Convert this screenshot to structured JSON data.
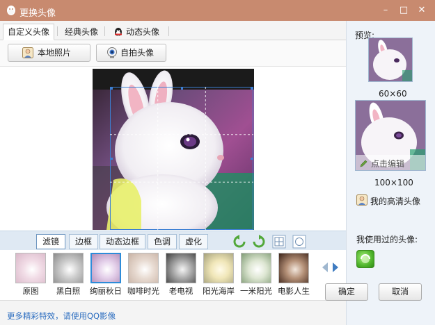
{
  "window": {
    "title": "更换头像",
    "icon": "qq-penguin-icon"
  },
  "title_controls": {
    "minimize": "–",
    "maximize": "□",
    "close": "✕"
  },
  "tabs": [
    {
      "label": "自定义头像",
      "active": true
    },
    {
      "label": "经典头像",
      "active": false
    },
    {
      "label": "动态头像",
      "active": false,
      "icon": "penguin-icon"
    }
  ],
  "toolbar": {
    "local_photo_label": "本地照片",
    "selfie_label": "自拍头像"
  },
  "filter_tabs": [
    {
      "label": "滤镜",
      "active": true
    },
    {
      "label": "边框",
      "active": false
    },
    {
      "label": "动态边框",
      "active": false
    },
    {
      "label": "色调",
      "active": false
    },
    {
      "label": "虚化",
      "active": false
    }
  ],
  "filters": [
    {
      "label": "原图",
      "selected": false,
      "tint": "#d9b7c8"
    },
    {
      "label": "黑白照",
      "selected": false,
      "tint": "#8a8a8a"
    },
    {
      "label": "绚丽秋日",
      "selected": true,
      "tint": "#b08bb6"
    },
    {
      "label": "咖啡时光",
      "selected": false,
      "tint": "#c8b2a4"
    },
    {
      "label": "老电视",
      "selected": false,
      "tint": "#5e5e5e"
    },
    {
      "label": "阳光海岸",
      "selected": false,
      "tint": "#e6d49c"
    },
    {
      "label": "一米阳光",
      "selected": false,
      "tint": "#b7c5a8"
    },
    {
      "label": "电影人生",
      "selected": false,
      "tint": "#6f4a3a"
    }
  ],
  "bottom": {
    "link_text": "更多精彩特效，请使用QQ影像"
  },
  "right_panel": {
    "preview_label": "预览:",
    "size_small": "60×60",
    "size_large": "100×100",
    "edit_label": "点击编辑",
    "hd_avatar_label": "我的高清头像",
    "used_label": "我使用过的头像:"
  },
  "buttons": {
    "ok": "确定",
    "cancel": "取消"
  },
  "colors": {
    "titlebar": "#c88a6f",
    "accent": "#2d8cd9",
    "link": "#2a6cbf"
  }
}
